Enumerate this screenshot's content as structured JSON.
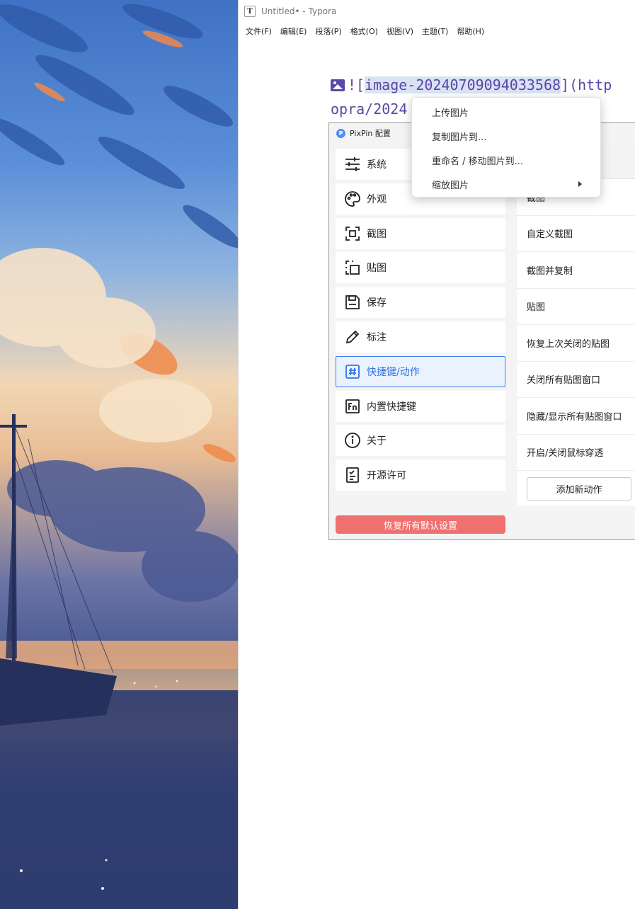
{
  "typora": {
    "window_title": "Untitled• - Typora",
    "app_icon_letter": "T",
    "menu": [
      "文件(F)",
      "编辑(E)",
      "段落(P)",
      "格式(O)",
      "视图(V)",
      "主题(T)",
      "帮助(H)"
    ],
    "markdown": {
      "line1_prefix": "![",
      "line1_alt": "image-20240709094033568",
      "line1_suffix": "](http",
      "line2": "opra/2024"
    }
  },
  "pixpin": {
    "title": "PixPin 配置",
    "logo_letter": "P",
    "nav": [
      {
        "label": "系统",
        "icon": "sliders-icon"
      },
      {
        "label": "外观",
        "icon": "palette-icon"
      },
      {
        "label": "截图",
        "icon": "screenshot-icon"
      },
      {
        "label": "贴图",
        "icon": "pin-image-icon"
      },
      {
        "label": "保存",
        "icon": "save-icon"
      },
      {
        "label": "标注",
        "icon": "pencil-icon"
      },
      {
        "label": "快捷键/动作",
        "icon": "hashtag-icon"
      },
      {
        "label": "内置快捷键",
        "icon": "fn-key-icon"
      },
      {
        "label": "关于",
        "icon": "info-icon"
      },
      {
        "label": "开源许可",
        "icon": "license-checklist-icon"
      }
    ],
    "active_nav": "快捷键/动作",
    "reset_button": "恢复所有默认设置",
    "actions": [
      "截图",
      "自定义截图",
      "截图并复制",
      "贴图",
      "恢复上次关闭的贴图",
      "关闭所有贴图窗口",
      "隐藏/显示所有贴图窗口",
      "开启/关闭鼠标穿透"
    ],
    "add_action_button": "添加新动作",
    "colors": {
      "accent": "#3a7de8",
      "danger": "#f07070"
    }
  },
  "context_menu": {
    "items": [
      {
        "label": "上传图片"
      },
      {
        "label": "复制图片到..."
      },
      {
        "label": "重命名 / 移动图片到..."
      },
      {
        "label": "缩放图片",
        "submenu_icon": "chevron-right-icon"
      }
    ]
  }
}
